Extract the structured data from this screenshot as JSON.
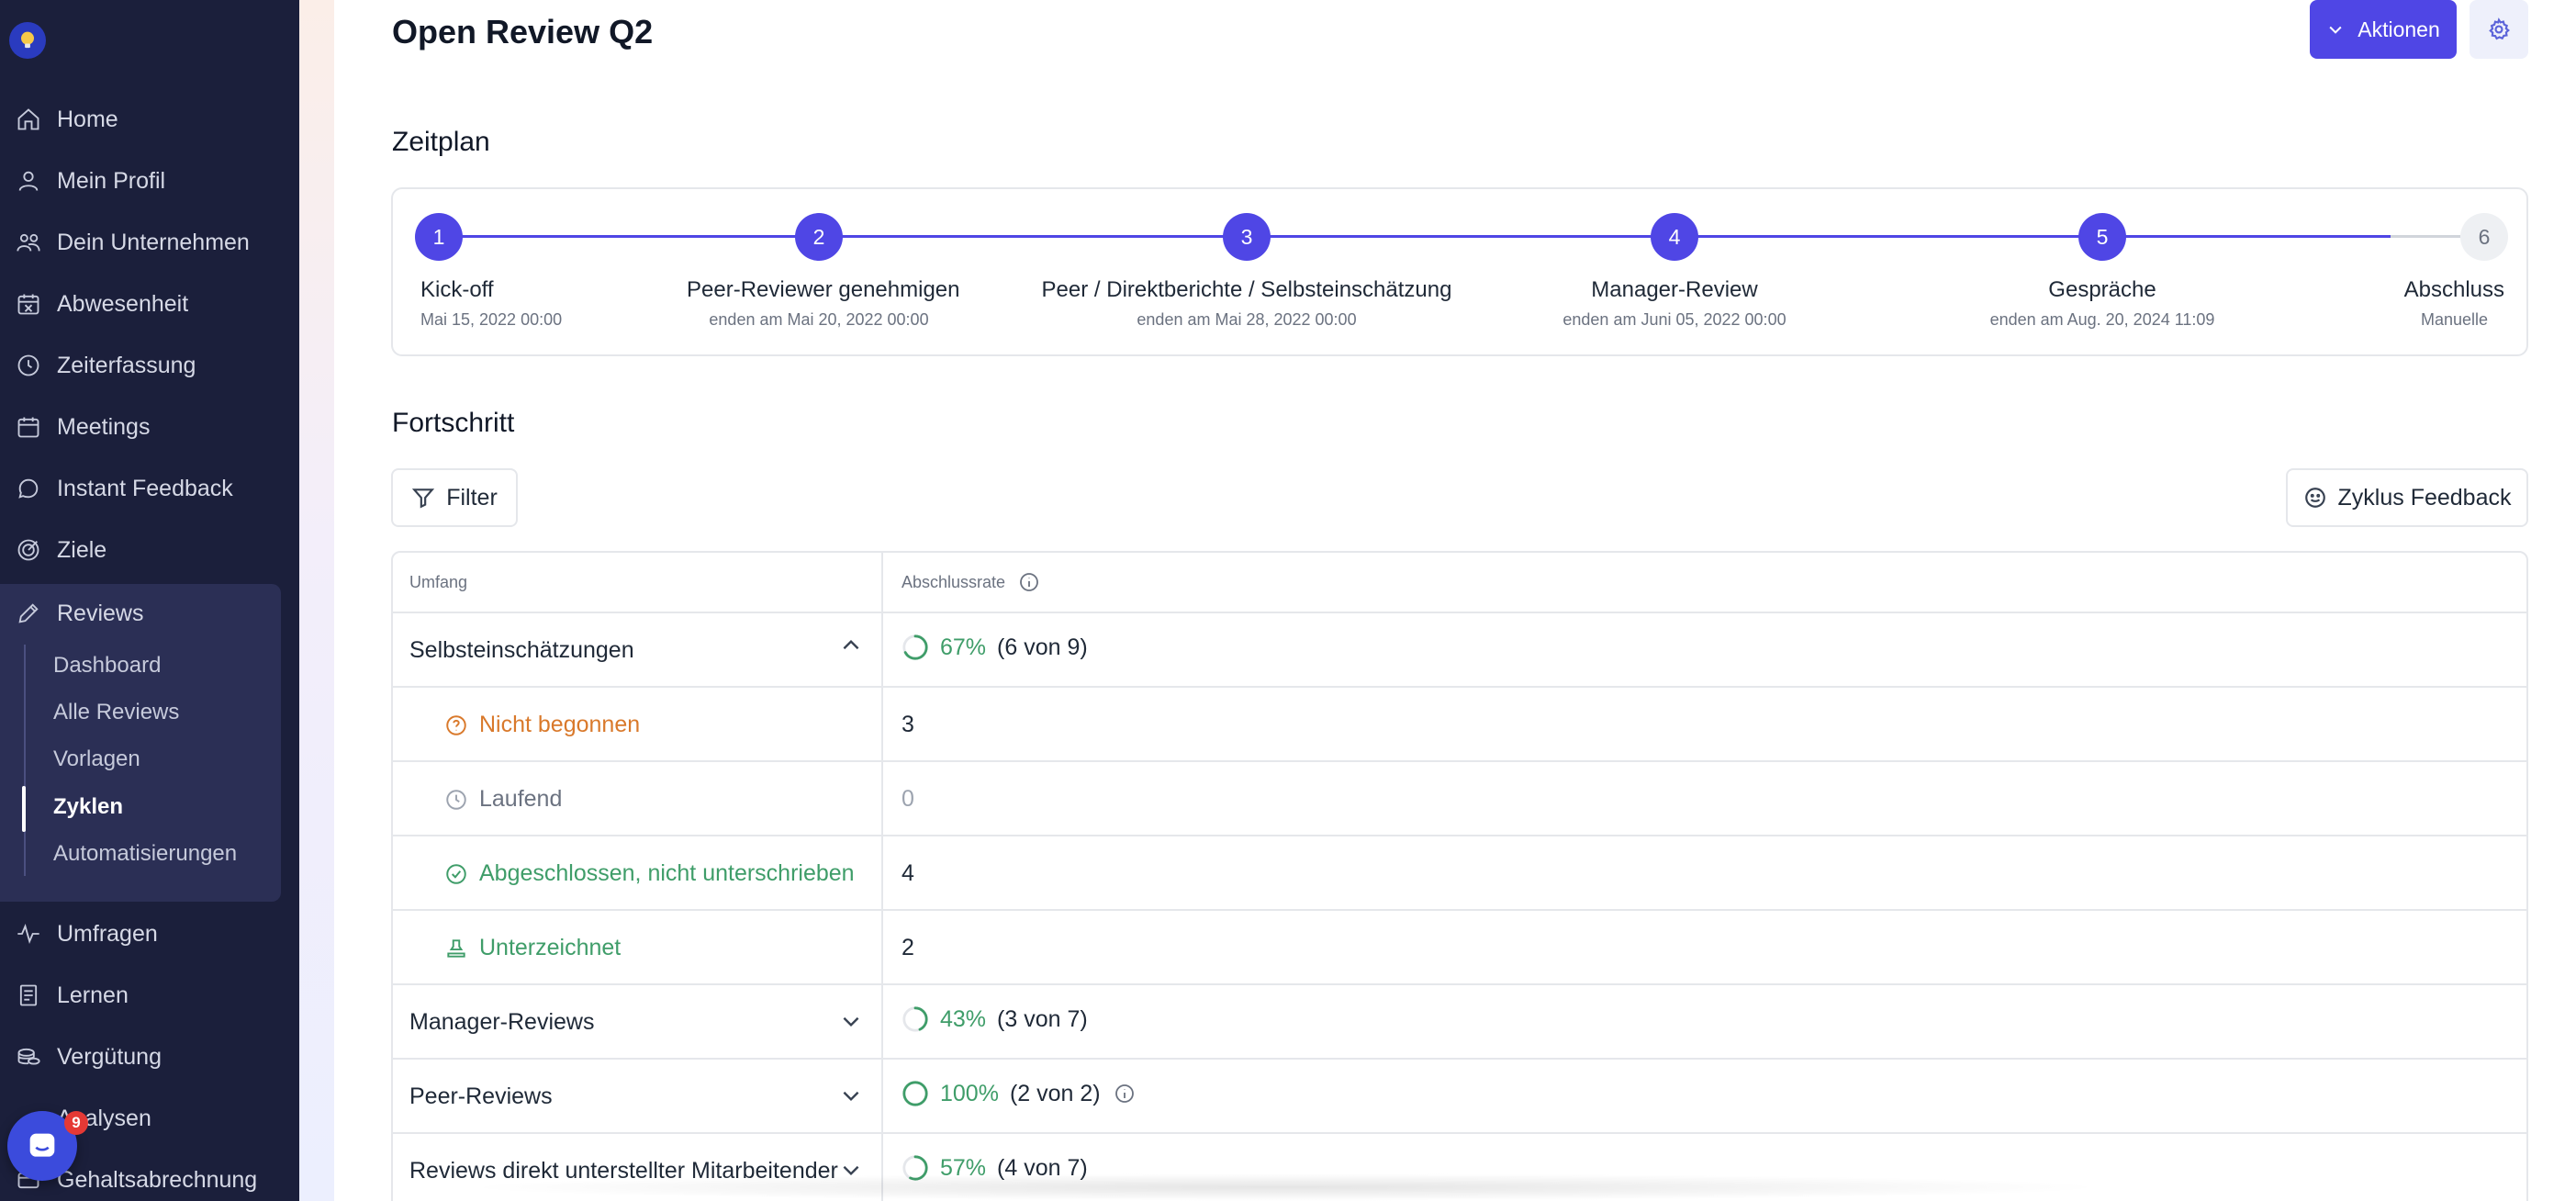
{
  "sidebar": {
    "items": [
      {
        "label": "Home",
        "icon": "home-icon"
      },
      {
        "label": "Mein Profil",
        "icon": "user-icon"
      },
      {
        "label": "Dein Unternehmen",
        "icon": "users-icon"
      },
      {
        "label": "Abwesenheit",
        "icon": "calendar-x-icon"
      },
      {
        "label": "Zeiterfassung",
        "icon": "clock-icon"
      },
      {
        "label": "Meetings",
        "icon": "calendar-icon"
      },
      {
        "label": "Instant Feedback",
        "icon": "chat-icon"
      },
      {
        "label": "Ziele",
        "icon": "target-icon"
      },
      {
        "label": "Reviews",
        "icon": "pencil-icon"
      },
      {
        "label": "Umfragen",
        "icon": "pulse-icon"
      },
      {
        "label": "Lernen",
        "icon": "book-icon"
      },
      {
        "label": "Vergütung",
        "icon": "coins-icon"
      },
      {
        "label": "Analysen",
        "icon": "chart-icon"
      },
      {
        "label": "Gehaltsabrechnung",
        "icon": "payroll-icon"
      }
    ],
    "reviews_sub": [
      "Dashboard",
      "Alle Reviews",
      "Vorlagen",
      "Zyklen",
      "Automatisierungen"
    ],
    "active_sub": "Zyklen",
    "chat_badge": "9"
  },
  "header": {
    "title": "Open Review Q2",
    "actions_label": "Aktionen"
  },
  "timeline": {
    "title": "Zeitplan",
    "steps": [
      {
        "num": "1",
        "label": "Kick-off",
        "sub": "Mai 15, 2022 00:00"
      },
      {
        "num": "2",
        "label": "Peer-Reviewer genehmigen",
        "sub": "enden am Mai 20, 2022 00:00"
      },
      {
        "num": "3",
        "label": "Peer / Direktberichte / Selbsteinschätzung",
        "sub": "enden am Mai 28, 2022 00:00"
      },
      {
        "num": "4",
        "label": "Manager-Review",
        "sub": "enden am Juni 05, 2022 00:00"
      },
      {
        "num": "5",
        "label": "Gespräche",
        "sub": "enden am Aug. 20, 2024 11:09"
      },
      {
        "num": "6",
        "label": "Abschluss",
        "sub": "Manuelle"
      }
    ]
  },
  "progress": {
    "title": "Fortschritt",
    "filter_label": "Filter",
    "feedback_label": "Zyklus Feedback",
    "columns": [
      "Umfang",
      "Abschlussrate"
    ],
    "rows": [
      {
        "scope": "Selbsteinschätzungen",
        "pct": "67%",
        "count": "(6 von 9)",
        "fraction": 0.67
      },
      {
        "scope": "Nicht begonnen",
        "value": "3"
      },
      {
        "scope": "Laufend",
        "value": "0"
      },
      {
        "scope": "Abgeschlossen, nicht unterschrieben",
        "value": "4"
      },
      {
        "scope": "Unterzeichnet",
        "value": "2"
      },
      {
        "scope": "Manager-Reviews",
        "pct": "43%",
        "count": "(3 von 7)",
        "fraction": 0.43
      },
      {
        "scope": "Peer-Reviews",
        "pct": "100%",
        "count": "(2 von 2)",
        "fraction": 1.0
      },
      {
        "scope": "Reviews direkt unterstellter Mitarbeitender",
        "pct": "57%",
        "count": "(4 von 7)",
        "fraction": 0.57
      }
    ]
  },
  "colors": {
    "accent": "#4f46e5",
    "sidebar": "#1b1f3b",
    "success": "#3f9d69",
    "warning": "#d9792b"
  }
}
